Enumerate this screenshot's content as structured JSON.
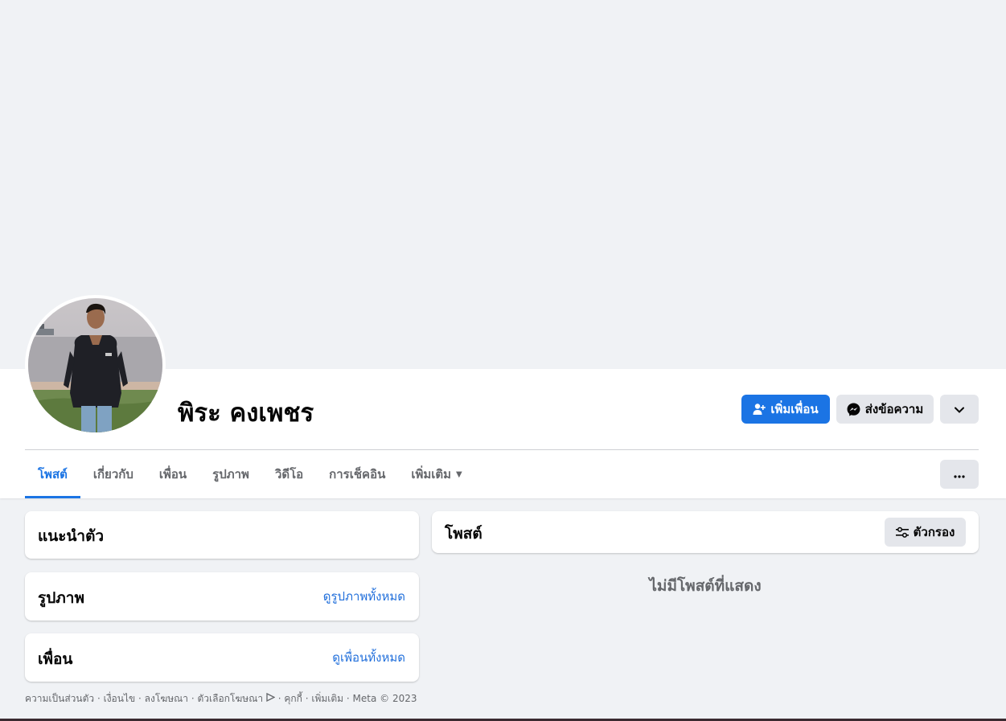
{
  "profile": {
    "name": "พิระ คงเพชร",
    "actions": {
      "add_friend": "เพิ่มเพื่อน",
      "message": "ส่งข้อความ"
    }
  },
  "tabs": [
    {
      "label": "โพสต์",
      "active": true
    },
    {
      "label": "เกี่ยวกับ"
    },
    {
      "label": "เพื่อน"
    },
    {
      "label": "รูปภาพ"
    },
    {
      "label": "วิดีโอ"
    },
    {
      "label": "การเช็คอิน"
    },
    {
      "label": "เพิ่มเติม"
    }
  ],
  "intro": {
    "title": "แนะนำตัว"
  },
  "photos": {
    "title": "รูปภาพ",
    "link": "ดูรูปภาพทั้งหมด"
  },
  "friends": {
    "title": "เพื่อน",
    "link": "ดูเพื่อนทั้งหมด"
  },
  "posts": {
    "title": "โพสต์",
    "filter_label": "ตัวกรอง",
    "empty_message": "ไม่มีโพสต์ที่แสดง"
  },
  "footer": {
    "links": [
      "ความเป็นส่วนตัว",
      "เงื่อนไข",
      "ลงโฆษณา",
      "ตัวเลือกโฆษณา",
      "คุกกี้",
      "เพิ่มเติม"
    ],
    "copyright": "Meta © 2023"
  },
  "colors": {
    "accent": "#1b74e4",
    "link": "#216fdb",
    "background": "#f0f2f5",
    "secondary_button": "#e4e6eb"
  },
  "icons": {
    "add_friend": "add-person-icon",
    "message": "messenger-icon",
    "dropdown": "chevron-down-icon",
    "more_tab": "caret-down-icon",
    "more": "ellipsis-icon",
    "filter": "sliders-icon",
    "ad_choices": "ad-choices-icon"
  }
}
